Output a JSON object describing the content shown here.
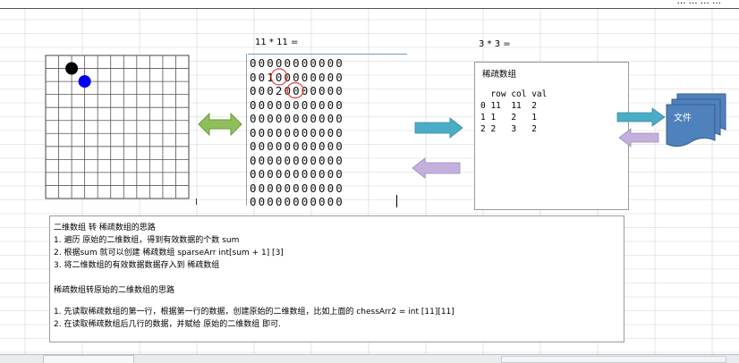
{
  "top_text": "… … … …",
  "original": {
    "caption": "11 * 11 =",
    "rows": [
      "00000000000",
      "00100000000",
      "00020000000",
      "00000000000",
      "00000000000",
      "00000000000",
      "00000000000",
      "00000000000",
      "00000000000",
      "00000000000",
      "00000000000"
    ],
    "grid_size": 11,
    "black_piece": {
      "row": 1,
      "col": 2
    },
    "blue_piece": {
      "row": 2,
      "col": 3
    }
  },
  "sparse": {
    "caption": "3 * 3 =",
    "title": "稀疏数组",
    "header": "  row col val",
    "rows": [
      "0 11  11  2",
      "1 1   2   1",
      "2 2   3   2"
    ]
  },
  "file_label": "文件",
  "notes": {
    "line1": "二维数组 转 稀疏数组的思路",
    "line2": "1. 遍历 原始的二维数组，得到有效数据的个数 sum",
    "line3": "2. 根据sum 就可以创建 稀疏数组 sparseArr int[sum + 1] [3]",
    "line4": "3. 将二维数组的有效数据数据存入到 稀疏数组",
    "line5": "稀疏数组转原始的二维数组的思路",
    "line6": "1. 先读取稀疏数组的第一行，根据第一行的数据，创建原始的二维数组，比如上面的  chessArr2 = int [11][11]",
    "line7": "2. 在读取稀疏数组后几行的数据，并赋给 原始的二维数组 即可."
  },
  "colors": {
    "grid_line": "#d4d4d4",
    "arrow_green": "#8fbf5a",
    "arrow_teal": "#4bacc6",
    "arrow_lilac": "#c3b0dc",
    "file_blue": "#4f81bd",
    "mark_red": "#e0423f",
    "piece_black": "#000000",
    "piece_blue": "#0000ee"
  }
}
